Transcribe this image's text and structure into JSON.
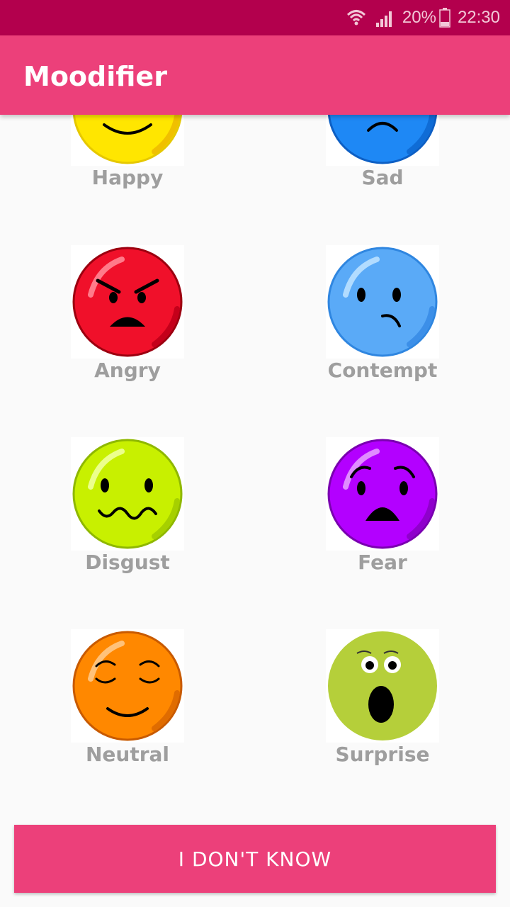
{
  "status_bar": {
    "battery_percent": "20%",
    "time": "22:30",
    "icons": [
      "wifi-icon",
      "signal-icon",
      "battery-icon"
    ]
  },
  "app_bar": {
    "title": "Moodifier"
  },
  "moods": [
    {
      "label": "Happy",
      "icon": "happy-face-icon",
      "color": "#ffe600"
    },
    {
      "label": "Sad",
      "icon": "sad-face-icon",
      "color": "#1e88f5"
    },
    {
      "label": "Angry",
      "icon": "angry-face-icon",
      "color": "#f0102a"
    },
    {
      "label": "Contempt",
      "icon": "contempt-face-icon",
      "color": "#5aaaf7"
    },
    {
      "label": "Disgust",
      "icon": "disgust-face-icon",
      "color": "#c8f000"
    },
    {
      "label": "Fear",
      "icon": "fear-face-icon",
      "color": "#b300ff"
    },
    {
      "label": "Neutral",
      "icon": "neutral-face-icon",
      "color": "#ff8800"
    },
    {
      "label": "Surprise",
      "icon": "surprise-face-icon",
      "color": "#b5cf3a"
    }
  ],
  "actions": {
    "dont_know_label": "I DON'T KNOW"
  },
  "colors": {
    "status_bar": "#b3004d",
    "primary": "#ec407a",
    "label_text": "#9e9e9e",
    "background": "#fafafa"
  }
}
